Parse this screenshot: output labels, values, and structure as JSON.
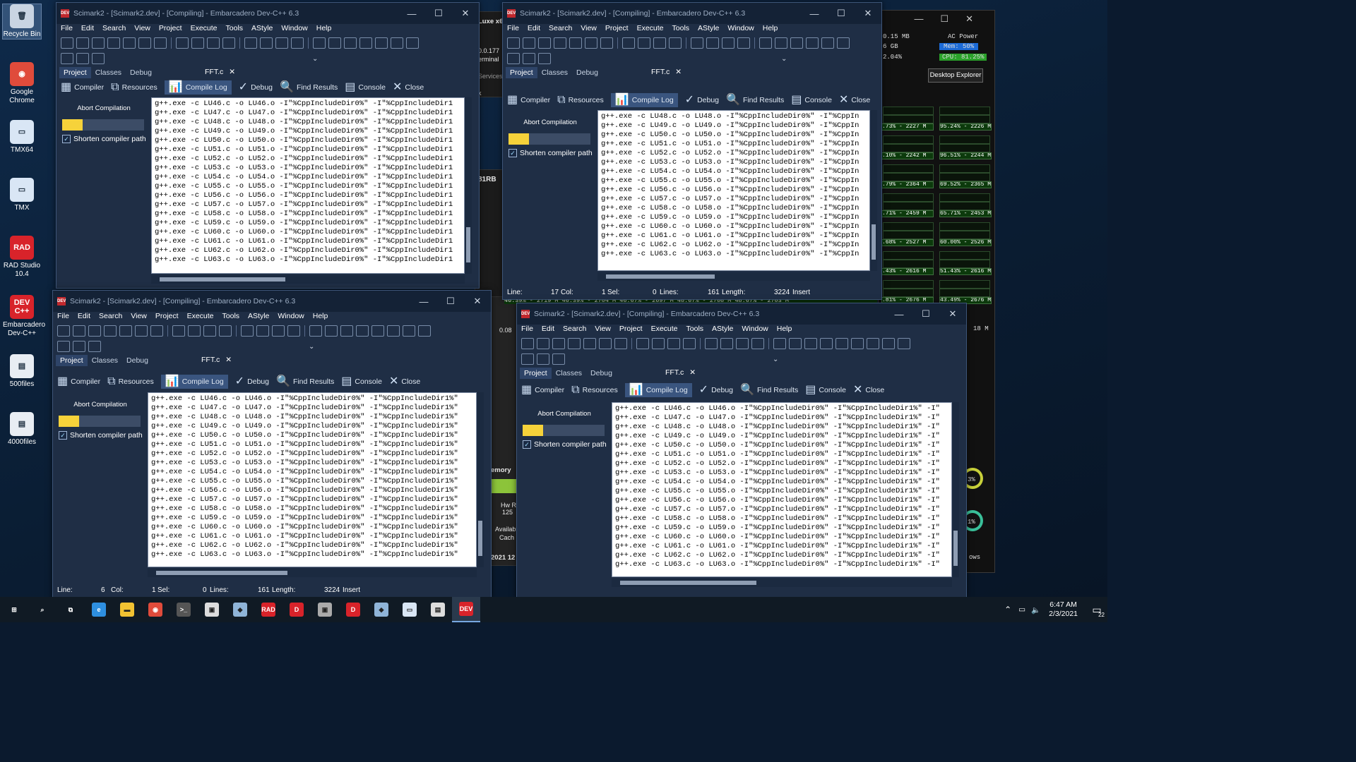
{
  "desktop": {
    "icons": [
      {
        "label": "Recycle Bin",
        "glyph": "🗑",
        "color": "#c9d4e2"
      },
      {
        "label": "Google Chrome",
        "glyph": "◉",
        "color": "#e04b3b"
      },
      {
        "label": "TMX64",
        "glyph": "▭",
        "color": "#d9e6f5"
      },
      {
        "label": "TMX",
        "glyph": "▭",
        "color": "#d9e6f5"
      },
      {
        "label": "RAD Studio 10.4",
        "glyph": "RAD",
        "color": "#d8232a"
      },
      {
        "label": "Embarcadero Dev-C++",
        "glyph": "DEV C++",
        "color": "#d8232a"
      },
      {
        "label": "500files",
        "glyph": "▤",
        "color": "#e8edf3"
      },
      {
        "label": "4000files",
        "glyph": "▤",
        "color": "#e8edf3"
      }
    ]
  },
  "background_fragments": {
    "a": "Luxe x6",
    "b": "0.0.177",
    "c": "erminal",
    "d": "Services",
    "e": "81RB",
    "f": "0.08",
    "g": "emory",
    "h": "Hw R",
    "i": "125",
    "j": "Availab",
    "k": "Cach",
    "l": "2021 12",
    "m": "ows",
    "n": "3%",
    "o": "1%",
    "p": "k"
  },
  "monitor": {
    "mem_used": "0.15 MB",
    "ac_power": "AC Power",
    "gb": "6 GB",
    "mem_label": "Mem: 50%",
    "cpu_pct": "2.04%",
    "cpu_label": "CPU: 81.25%",
    "desktop_explorer": "Desktop Explorer",
    "rows": [
      {
        "left": ".73% - 2227 M",
        "right": "95.24% - 2226 M"
      },
      {
        "left": ".10% - 2242 M",
        "right": "96.51% - 2244 M"
      },
      {
        "left": ".79% - 2364 M",
        "right": "69.52% - 2365 M"
      },
      {
        "left": ".71% - 2459 M",
        "right": "65.71% - 2453 M"
      },
      {
        "left": ".68% - 2527 M",
        "right": "60.00% - 2526 M"
      },
      {
        "left": ".43% - 2616 M",
        "right": "51.43% - 2616 M"
      },
      {
        "left": ".81% - 2676 M",
        "right": "43.49% - 2676 M"
      }
    ],
    "bottom_row": "18 M",
    "mid_strip": "46.39% - 2719 M  46.39% - 2704 M  46.67% - 2697 M  48.67% - 2708 M  48.67% - 2703 M"
  },
  "ide": {
    "title": "Scimark2 - [Scimark2.dev] - [Compiling] - Embarcadero Dev-C++ 6.3",
    "menu": [
      "File",
      "Edit",
      "Search",
      "View",
      "Project",
      "Execute",
      "Tools",
      "AStyle",
      "Window",
      "Help"
    ],
    "left_tabs": [
      "Project",
      "Classes",
      "Debug"
    ],
    "file_tab": "FFT.c",
    "file_tab_close": "✕",
    "panel_tabs": [
      "Compiler",
      "Resources",
      "Compile Log",
      "Debug",
      "Find Results",
      "Console",
      "Close"
    ],
    "panel_icons": [
      "▦",
      "⧉",
      "📊",
      "✓",
      "🔍",
      "▤",
      "✕"
    ],
    "abort": "Abort Compilation",
    "shorten": "Shorten compiler path",
    "check_mark": "✓",
    "title_controls": [
      "—",
      "☐",
      "✕"
    ],
    "status": {
      "line": "Line:",
      "col": "Col:",
      "sel": "Sel:",
      "lines": "Lines:",
      "length": "Length:",
      "insert": "Insert"
    },
    "status_values_a": {
      "line": "",
      "col": "6",
      "sel": "1",
      "lines": "0",
      "length": "161",
      "insert_val": "3224"
    },
    "status_values_b": {
      "line": "",
      "col": "17",
      "sel": "1",
      "lines": "0",
      "length": "161",
      "insert_val": "3224"
    }
  },
  "logs": {
    "w1": [
      "g++.exe -c LU46.c -o LU46.o -I\"%CppIncludeDir0%\" -I\"%CppIncludeDir1",
      "g++.exe -c LU47.c -o LU47.o -I\"%CppIncludeDir0%\" -I\"%CppIncludeDir1",
      "g++.exe -c LU48.c -o LU48.o -I\"%CppIncludeDir0%\" -I\"%CppIncludeDir1",
      "g++.exe -c LU49.c -o LU49.o -I\"%CppIncludeDir0%\" -I\"%CppIncludeDir1",
      "g++.exe -c LU50.c -o LU50.o -I\"%CppIncludeDir0%\" -I\"%CppIncludeDir1",
      "g++.exe -c LU51.c -o LU51.o -I\"%CppIncludeDir0%\" -I\"%CppIncludeDir1",
      "g++.exe -c LU52.c -o LU52.o -I\"%CppIncludeDir0%\" -I\"%CppIncludeDir1",
      "g++.exe -c LU53.c -o LU53.o -I\"%CppIncludeDir0%\" -I\"%CppIncludeDir1",
      "g++.exe -c LU54.c -o LU54.o -I\"%CppIncludeDir0%\" -I\"%CppIncludeDir1",
      "g++.exe -c LU55.c -o LU55.o -I\"%CppIncludeDir0%\" -I\"%CppIncludeDir1",
      "g++.exe -c LU56.c -o LU56.o -I\"%CppIncludeDir0%\" -I\"%CppIncludeDir1",
      "g++.exe -c LU57.c -o LU57.o -I\"%CppIncludeDir0%\" -I\"%CppIncludeDir1",
      "g++.exe -c LU58.c -o LU58.o -I\"%CppIncludeDir0%\" -I\"%CppIncludeDir1",
      "g++.exe -c LU59.c -o LU59.o -I\"%CppIncludeDir0%\" -I\"%CppIncludeDir1",
      "g++.exe -c LU60.c -o LU60.o -I\"%CppIncludeDir0%\" -I\"%CppIncludeDir1",
      "g++.exe -c LU61.c -o LU61.o -I\"%CppIncludeDir0%\" -I\"%CppIncludeDir1",
      "g++.exe -c LU62.c -o LU62.o -I\"%CppIncludeDir0%\" -I\"%CppIncludeDir1",
      "g++.exe -c LU63.c -o LU63.o -I\"%CppIncludeDir0%\" -I\"%CppIncludeDir1"
    ],
    "w2": [
      "g++.exe -c LU48.c -o LU48.o -I\"%CppIncludeDir0%\" -I\"%CppIn",
      "g++.exe -c LU49.c -o LU49.o -I\"%CppIncludeDir0%\" -I\"%CppIn",
      "g++.exe -c LU50.c -o LU50.o -I\"%CppIncludeDir0%\" -I\"%CppIn",
      "g++.exe -c LU51.c -o LU51.o -I\"%CppIncludeDir0%\" -I\"%CppIn",
      "g++.exe -c LU52.c -o LU52.o -I\"%CppIncludeDir0%\" -I\"%CppIn",
      "g++.exe -c LU53.c -o LU53.o -I\"%CppIncludeDir0%\" -I\"%CppIn",
      "g++.exe -c LU54.c -o LU54.o -I\"%CppIncludeDir0%\" -I\"%CppIn",
      "g++.exe -c LU55.c -o LU55.o -I\"%CppIncludeDir0%\" -I\"%CppIn",
      "g++.exe -c LU56.c -o LU56.o -I\"%CppIncludeDir0%\" -I\"%CppIn",
      "g++.exe -c LU57.c -o LU57.o -I\"%CppIncludeDir0%\" -I\"%CppIn",
      "g++.exe -c LU58.c -o LU58.o -I\"%CppIncludeDir0%\" -I\"%CppIn",
      "g++.exe -c LU59.c -o LU59.o -I\"%CppIncludeDir0%\" -I\"%CppIn",
      "g++.exe -c LU60.c -o LU60.o -I\"%CppIncludeDir0%\" -I\"%CppIn",
      "g++.exe -c LU61.c -o LU61.o -I\"%CppIncludeDir0%\" -I\"%CppIn",
      "g++.exe -c LU62.c -o LU62.o -I\"%CppIncludeDir0%\" -I\"%CppIn",
      "g++.exe -c LU63.c -o LU63.o -I\"%CppIncludeDir0%\" -I\"%CppIn"
    ],
    "w3": [
      "g++.exe -c LU46.c -o LU46.o -I\"%CppIncludeDir0%\" -I\"%CppIncludeDir1%\"",
      "g++.exe -c LU47.c -o LU47.o -I\"%CppIncludeDir0%\" -I\"%CppIncludeDir1%\"",
      "g++.exe -c LU48.c -o LU48.o -I\"%CppIncludeDir0%\" -I\"%CppIncludeDir1%\"",
      "g++.exe -c LU49.c -o LU49.o -I\"%CppIncludeDir0%\" -I\"%CppIncludeDir1%\"",
      "g++.exe -c LU50.c -o LU50.o -I\"%CppIncludeDir0%\" -I\"%CppIncludeDir1%\"",
      "g++.exe -c LU51.c -o LU51.o -I\"%CppIncludeDir0%\" -I\"%CppIncludeDir1%\"",
      "g++.exe -c LU52.c -o LU52.o -I\"%CppIncludeDir0%\" -I\"%CppIncludeDir1%\"",
      "g++.exe -c LU53.c -o LU53.o -I\"%CppIncludeDir0%\" -I\"%CppIncludeDir1%\"",
      "g++.exe -c LU54.c -o LU54.o -I\"%CppIncludeDir0%\" -I\"%CppIncludeDir1%\"",
      "g++.exe -c LU55.c -o LU55.o -I\"%CppIncludeDir0%\" -I\"%CppIncludeDir1%\"",
      "g++.exe -c LU56.c -o LU56.o -I\"%CppIncludeDir0%\" -I\"%CppIncludeDir1%\"",
      "g++.exe -c LU57.c -o LU57.o -I\"%CppIncludeDir0%\" -I\"%CppIncludeDir1%\"",
      "g++.exe -c LU58.c -o LU58.o -I\"%CppIncludeDir0%\" -I\"%CppIncludeDir1%\"",
      "g++.exe -c LU59.c -o LU59.o -I\"%CppIncludeDir0%\" -I\"%CppIncludeDir1%\"",
      "g++.exe -c LU60.c -o LU60.o -I\"%CppIncludeDir0%\" -I\"%CppIncludeDir1%\"",
      "g++.exe -c LU61.c -o LU61.o -I\"%CppIncludeDir0%\" -I\"%CppIncludeDir1%\"",
      "g++.exe -c LU62.c -o LU62.o -I\"%CppIncludeDir0%\" -I\"%CppIncludeDir1%\"",
      "g++.exe -c LU63.c -o LU63.o -I\"%CppIncludeDir0%\" -I\"%CppIncludeDir1%\""
    ],
    "w4": [
      "g++.exe -c LU46.c -o LU46.o -I\"%CppIncludeDir0%\" -I\"%CppIncludeDir1%\" -I\"",
      "g++.exe -c LU47.c -o LU47.o -I\"%CppIncludeDir0%\" -I\"%CppIncludeDir1%\" -I\"",
      "g++.exe -c LU48.c -o LU48.o -I\"%CppIncludeDir0%\" -I\"%CppIncludeDir1%\" -I\"",
      "g++.exe -c LU49.c -o LU49.o -I\"%CppIncludeDir0%\" -I\"%CppIncludeDir1%\" -I\"",
      "g++.exe -c LU50.c -o LU50.o -I\"%CppIncludeDir0%\" -I\"%CppIncludeDir1%\" -I\"",
      "g++.exe -c LU51.c -o LU51.o -I\"%CppIncludeDir0%\" -I\"%CppIncludeDir1%\" -I\"",
      "g++.exe -c LU52.c -o LU52.o -I\"%CppIncludeDir0%\" -I\"%CppIncludeDir1%\" -I\"",
      "g++.exe -c LU53.c -o LU53.o -I\"%CppIncludeDir0%\" -I\"%CppIncludeDir1%\" -I\"",
      "g++.exe -c LU54.c -o LU54.o -I\"%CppIncludeDir0%\" -I\"%CppIncludeDir1%\" -I\"",
      "g++.exe -c LU55.c -o LU55.o -I\"%CppIncludeDir0%\" -I\"%CppIncludeDir1%\" -I\"",
      "g++.exe -c LU56.c -o LU56.o -I\"%CppIncludeDir0%\" -I\"%CppIncludeDir1%\" -I\"",
      "g++.exe -c LU57.c -o LU57.o -I\"%CppIncludeDir0%\" -I\"%CppIncludeDir1%\" -I\"",
      "g++.exe -c LU58.c -o LU58.o -I\"%CppIncludeDir0%\" -I\"%CppIncludeDir1%\" -I\"",
      "g++.exe -c LU59.c -o LU59.o -I\"%CppIncludeDir0%\" -I\"%CppIncludeDir1%\" -I\"",
      "g++.exe -c LU60.c -o LU60.o -I\"%CppIncludeDir0%\" -I\"%CppIncludeDir1%\" -I\"",
      "g++.exe -c LU61.c -o LU61.o -I\"%CppIncludeDir0%\" -I\"%CppIncludeDir1%\" -I\"",
      "g++.exe -c LU62.c -o LU62.o -I\"%CppIncludeDir0%\" -I\"%CppIncludeDir1%\" -I\"",
      "g++.exe -c LU63.c -o LU63.o -I\"%CppIncludeDir0%\" -I\"%CppIncludeDir1%\" -I\""
    ]
  },
  "progress": {
    "fraction": 0.25
  },
  "taskbar": {
    "apps": [
      {
        "glyph": "⊞",
        "color": "#ffffff",
        "name": "start-button"
      },
      {
        "glyph": "⌕",
        "color": "#ffffff",
        "name": "search-button"
      },
      {
        "glyph": "⧉",
        "color": "#ffffff",
        "name": "task-view-button"
      },
      {
        "glyph": "e",
        "color": "#2e8fe0",
        "name": "taskbar-edge"
      },
      {
        "glyph": "▬",
        "color": "#f1c232",
        "name": "taskbar-file-explorer"
      },
      {
        "glyph": "◉",
        "color": "#e04b3b",
        "name": "taskbar-chrome"
      },
      {
        "glyph": ">_",
        "color": "#555555",
        "name": "taskbar-terminal"
      },
      {
        "glyph": "▣",
        "color": "#dddddd",
        "name": "taskbar-app-a"
      },
      {
        "glyph": "◆",
        "color": "#8fb4d8",
        "name": "taskbar-app-b"
      },
      {
        "glyph": "RAD",
        "color": "#d8232a",
        "name": "taskbar-rad-studio"
      },
      {
        "glyph": "D",
        "color": "#d8232a",
        "name": "taskbar-delphi-a"
      },
      {
        "glyph": "▣",
        "color": "#aaaaaa",
        "name": "taskbar-app-c"
      },
      {
        "glyph": "D",
        "color": "#d8232a",
        "name": "taskbar-delphi-b"
      },
      {
        "glyph": "◆",
        "color": "#8fb4d8",
        "name": "taskbar-app-d"
      },
      {
        "glyph": "▭",
        "color": "#d9e6f5",
        "name": "taskbar-tmx"
      },
      {
        "glyph": "▤",
        "color": "#dddddd",
        "name": "taskbar-notepad"
      },
      {
        "glyph": "DEV",
        "color": "#d8232a",
        "name": "taskbar-devcpp"
      }
    ],
    "time": "6:47 AM",
    "date": "2/3/2021",
    "notif_count": "22",
    "tray_glyphs": [
      "⌃",
      "▭",
      "🔈"
    ]
  }
}
